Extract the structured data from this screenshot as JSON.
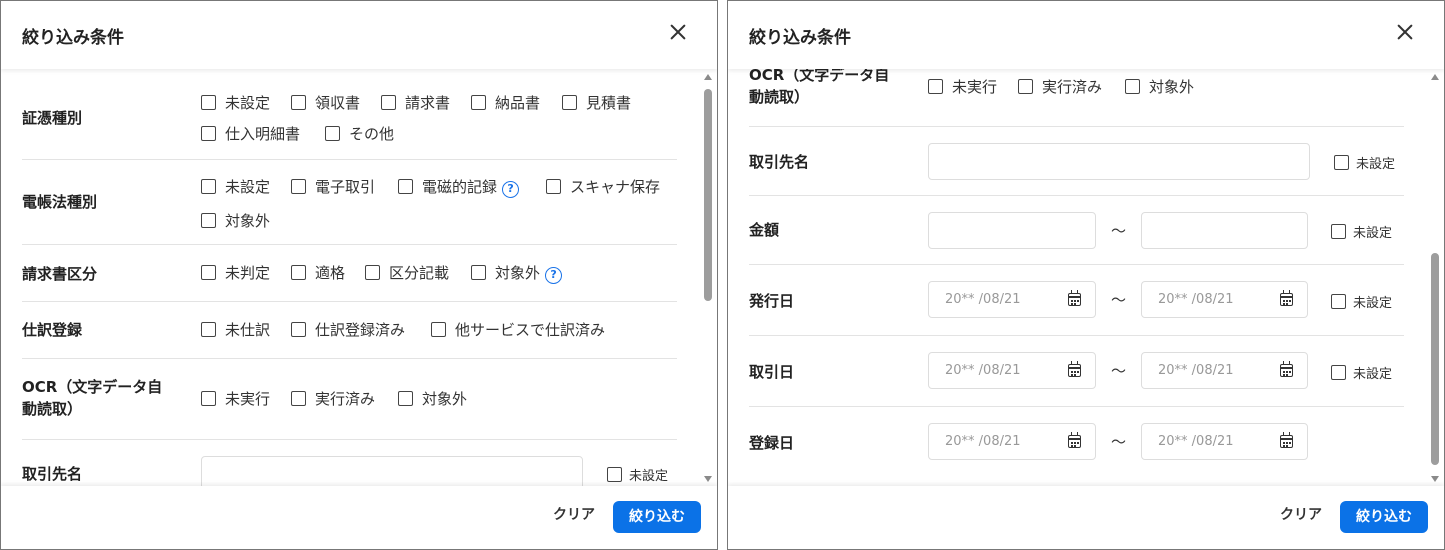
{
  "dialog": {
    "title": "絞り込み条件",
    "clear_label": "クリア",
    "apply_label": "絞り込む"
  },
  "filters": {
    "voucher_type": {
      "label": "証憑種別",
      "options": [
        "未設定",
        "領収書",
        "請求書",
        "納品書",
        "見積書",
        "仕入明細書",
        "その他"
      ]
    },
    "ebook_type": {
      "label": "電帳法種別",
      "options": [
        "未設定",
        "電子取引",
        "電磁的記録",
        "スキャナ保存",
        "対象外"
      ]
    },
    "invoice_category": {
      "label": "請求書区分",
      "options": [
        "未判定",
        "適格",
        "区分記載",
        "対象外"
      ]
    },
    "journal_registration": {
      "label": "仕訳登録",
      "options": [
        "未仕訳",
        "仕訳登録済み",
        "他サービスで仕訳済み"
      ]
    },
    "ocr": {
      "label_line1": "OCR（文字データ自",
      "label_line2": "動読取）",
      "options": [
        "未実行",
        "実行済み",
        "対象外"
      ]
    },
    "partner": {
      "label": "取引先名",
      "value": "",
      "unset_label": "未設定"
    },
    "amount": {
      "label": "金額",
      "from": "",
      "to": "",
      "separator": "〜",
      "unset_label": "未設定"
    },
    "issue_date": {
      "label": "発行日",
      "placeholder_from": "20** /08/21",
      "placeholder_to": "20** /08/21",
      "separator": "〜",
      "unset_label": "未設定"
    },
    "transaction_date": {
      "label": "取引日",
      "placeholder_from": "20** /08/21",
      "placeholder_to": "20** /08/21",
      "separator": "〜",
      "unset_label": "未設定"
    },
    "registration_date": {
      "label": "登録日",
      "placeholder_from": "20** /08/21",
      "placeholder_to": "20** /08/21",
      "separator": "〜"
    }
  },
  "icons": {
    "close": "close-icon",
    "help": "help-circle-icon",
    "calendar": "calendar-icon",
    "checkbox": "checkbox-icon"
  },
  "colors": {
    "primary": "#0b72e7",
    "help": "#1a73e8"
  },
  "help_glyph": "?"
}
